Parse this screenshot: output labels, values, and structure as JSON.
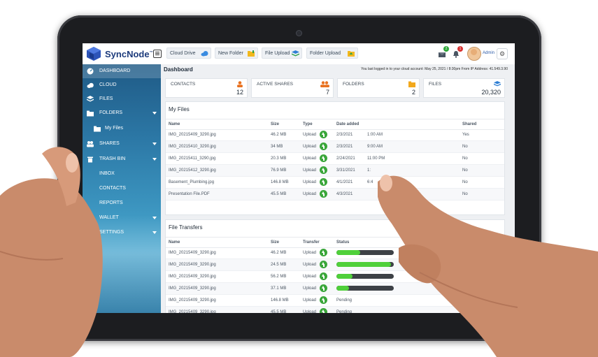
{
  "app": {
    "brand": "SyncNode",
    "brand_mark": "™"
  },
  "toolbar": [
    {
      "label": "Cloud Drive",
      "icon": "cloud-icon"
    },
    {
      "label": "New Folder",
      "icon": "new-folder-icon"
    },
    {
      "label": "File Upload",
      "icon": "stack-icon"
    },
    {
      "label": "Folder Upload",
      "icon": "folder-upload-icon"
    }
  ],
  "header": {
    "notifications": [
      {
        "icon": "inbox-icon",
        "count": "2",
        "color": "#2fa83a"
      },
      {
        "icon": "bell-icon",
        "count": "1",
        "color": "#d83232"
      }
    ],
    "user": "Admin"
  },
  "sidebar": {
    "items": [
      {
        "label": "DASHBOARD",
        "icon": "dashboard-icon",
        "active": true
      },
      {
        "label": "CLOUD",
        "icon": "cloud-icon"
      },
      {
        "label": "FILES",
        "icon": "layers-icon"
      },
      {
        "label": "FOLDERS",
        "icon": "folder-icon",
        "caret": true
      },
      {
        "label": "My Files",
        "icon": "folder-icon",
        "sub": true
      },
      {
        "label": "SHARES",
        "icon": "people-icon",
        "caret": true
      },
      {
        "label": "TRASH BIN",
        "icon": "trash-icon",
        "caret": true
      },
      {
        "label": "INBOX"
      },
      {
        "label": "CONTACTS"
      },
      {
        "label": "REPORTS"
      },
      {
        "label": "WALLET",
        "caret": true
      },
      {
        "label": "SETTINGS",
        "caret": true
      }
    ]
  },
  "dashboard": {
    "title": "Dashboard",
    "last_login": "You last logged in to your cloud account: May 25, 2021 / 8:30pm From IP Address: 41.549.3.90",
    "stats": [
      {
        "label": "CONTACTS",
        "value": "12",
        "icon": "person-icon",
        "color": "#e8711f"
      },
      {
        "label": "ACTIVE SHARES",
        "value": "7",
        "icon": "people-icon",
        "color": "#e8711f"
      },
      {
        "label": "FOLDERS",
        "value": "2",
        "icon": "folder-icon",
        "color": "#f2a81d"
      },
      {
        "label": "FILES",
        "value": "20,320",
        "icon": "layers-icon",
        "color": "#2f7fd4"
      }
    ]
  },
  "my_files": {
    "title": "My Files",
    "columns": [
      "Name",
      "Size",
      "Type",
      "Date added",
      "Shared"
    ],
    "rows": [
      {
        "name": "IMG_20215409_3290.jpg",
        "size": "46.2 MB",
        "type": "Upload",
        "date": "2/3/2021",
        "time": "1:00 AM",
        "shared": "Yes"
      },
      {
        "name": "IMG_20215410_3290.jpg",
        "size": "34 MB",
        "type": "Upload",
        "date": "2/3/2021",
        "time": "9:00 AM",
        "shared": "No"
      },
      {
        "name": "IMG_20215411_3290.jpg",
        "size": "20.3 MB",
        "type": "Upload",
        "date": "2/24/2021",
        "time": "11:00 PM",
        "shared": "No"
      },
      {
        "name": "IMG_20215412_3290.jpg",
        "size": "76.9 MB",
        "type": "Upload",
        "date": "3/31/2021",
        "time": "1:",
        "shared": "No"
      },
      {
        "name": "Basement_Plumbing.jpg",
        "size": "146.8 MB",
        "type": "Upload",
        "date": "4/1/2021",
        "time": "6:4",
        "shared": "No"
      },
      {
        "name": "Presentation File.PDF",
        "size": "45.5 MB",
        "type": "Upload",
        "date": "4/3/2021",
        "time": "",
        "shared": "No"
      }
    ]
  },
  "transfers": {
    "title": "File Transfers",
    "columns": [
      "Name",
      "Size",
      "Transfer",
      "Status"
    ],
    "rows": [
      {
        "name": "IMG_20215409_3290.jpg",
        "size": "46.2 MB",
        "type": "Upload",
        "progress": 0.42,
        "status": ""
      },
      {
        "name": "IMG_20215409_3290.jpg",
        "size": "24.5 MB",
        "type": "Upload",
        "progress": 0.95,
        "status": ""
      },
      {
        "name": "IMG_20215409_3290.jpg",
        "size": "56.2 MB",
        "type": "Upload",
        "progress": 0.28,
        "status": ""
      },
      {
        "name": "IMG_20215409_3290.jpg",
        "size": "37.1 MB",
        "type": "Upload",
        "progress": 0.22,
        "status": ""
      },
      {
        "name": "IMG_20215409_3290.jpg",
        "size": "146.8 MB",
        "type": "Upload",
        "progress": null,
        "status": "Pending"
      },
      {
        "name": "IMG_20215409_3290.jpg",
        "size": "45.5 MB",
        "type": "Upload",
        "progress": null,
        "status": "Pending"
      }
    ]
  }
}
